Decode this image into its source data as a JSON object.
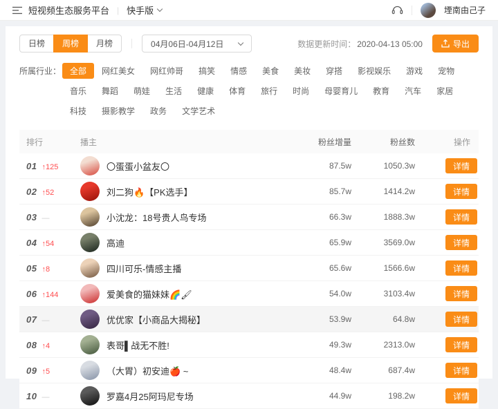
{
  "header": {
    "title": "短视频生态服务平台",
    "divider": "|",
    "version_label": "快手版",
    "username": "堙南由己子",
    "icons": {
      "menu": "menu-fold-icon",
      "headset": "headset-icon",
      "chevron": "chevron-down-icon"
    }
  },
  "toolbar": {
    "tabs": [
      {
        "label": "日榜",
        "active": false
      },
      {
        "label": "周榜",
        "active": true
      },
      {
        "label": "月榜",
        "active": false
      }
    ],
    "date_range": "04月06日-04月12日",
    "update_label": "数据更新时间：",
    "update_time": "2020-04-13 05:00",
    "export_label": "导出"
  },
  "filters": {
    "label": "所属行业：",
    "active": "全部",
    "options": [
      "全部",
      "网红美女",
      "网红帅哥",
      "搞笑",
      "情感",
      "美食",
      "美妆",
      "穿搭",
      "影视娱乐",
      "游戏",
      "宠物",
      "音乐",
      "舞蹈",
      "萌娃",
      "生活",
      "健康",
      "体育",
      "旅行",
      "时尚",
      "母婴育儿",
      "教育",
      "汽车",
      "家居",
      "科技",
      "摄影教学",
      "政务",
      "文学艺术"
    ]
  },
  "table": {
    "columns": {
      "rank": "排行",
      "owner": "播主",
      "gain": "粉丝增量",
      "fans": "粉丝数",
      "action": "操作"
    },
    "action_label": "详情",
    "icons": {
      "up_arrow": "↑",
      "flat": "—"
    },
    "rows": [
      {
        "rank": "01",
        "change": "125",
        "trend": "up",
        "name": "〇蛋蛋小盆友〇",
        "gain": "87.5w",
        "fans": "1050.3w",
        "highlight": false,
        "avatar": [
          "#f3ddd1",
          "#dd6a5e"
        ]
      },
      {
        "rank": "02",
        "change": "52",
        "trend": "up",
        "name": "刘二狗🔥【PK选手】",
        "gain": "85.7w",
        "fans": "1414.2w",
        "highlight": false,
        "avatar": [
          "#e6392b",
          "#a81a10"
        ]
      },
      {
        "rank": "03",
        "change": "",
        "trend": "flat",
        "name": "小沈龙：18号贵人鸟专场",
        "gain": "66.3w",
        "fans": "1888.3w",
        "highlight": false,
        "avatar": [
          "#dcc49e",
          "#6e5c45"
        ]
      },
      {
        "rank": "04",
        "change": "54",
        "trend": "up",
        "name": "高迪",
        "gain": "65.9w",
        "fans": "3569.0w",
        "highlight": false,
        "avatar": [
          "#78806a",
          "#2e382d"
        ]
      },
      {
        "rank": "05",
        "change": "8",
        "trend": "up",
        "name": "四川可乐-情感主播",
        "gain": "65.6w",
        "fans": "1566.6w",
        "highlight": false,
        "avatar": [
          "#ecd2b8",
          "#8d7159"
        ]
      },
      {
        "rank": "06",
        "change": "144",
        "trend": "up",
        "name": "爱美食的猫妹妹🌈🖌",
        "gain": "54.0w",
        "fans": "3103.4w",
        "highlight": false,
        "avatar": [
          "#f2b9b9",
          "#d34a4a"
        ]
      },
      {
        "rank": "07",
        "change": "",
        "trend": "flat",
        "name": "优优家【小商品大揭秘】",
        "gain": "53.9w",
        "fans": "64.8w",
        "highlight": true,
        "avatar": [
          "#6f5b83",
          "#41304f"
        ]
      },
      {
        "rank": "08",
        "change": "4",
        "trend": "up",
        "name": "表哥▌战无不胜!",
        "gain": "49.3w",
        "fans": "2313.0w",
        "highlight": false,
        "avatar": [
          "#a3b092",
          "#586a4e"
        ]
      },
      {
        "rank": "09",
        "change": "5",
        "trend": "up",
        "name": "（大胃）初安迪🍎 ~",
        "gain": "48.4w",
        "fans": "687.4w",
        "highlight": false,
        "avatar": [
          "#d8dce2",
          "#98a2b3"
        ]
      },
      {
        "rank": "10",
        "change": "",
        "trend": "flat",
        "name": "罗嘉4月25阿玛尼专场",
        "gain": "44.9w",
        "fans": "198.2w",
        "highlight": false,
        "avatar": [
          "#5a5a5a",
          "#1f1f1f"
        ]
      }
    ]
  },
  "colors": {
    "accent": "#fa8c16",
    "rise": "#ff4d4f",
    "flat": "#cccccc",
    "row_highlight": "#f5f5f5"
  }
}
